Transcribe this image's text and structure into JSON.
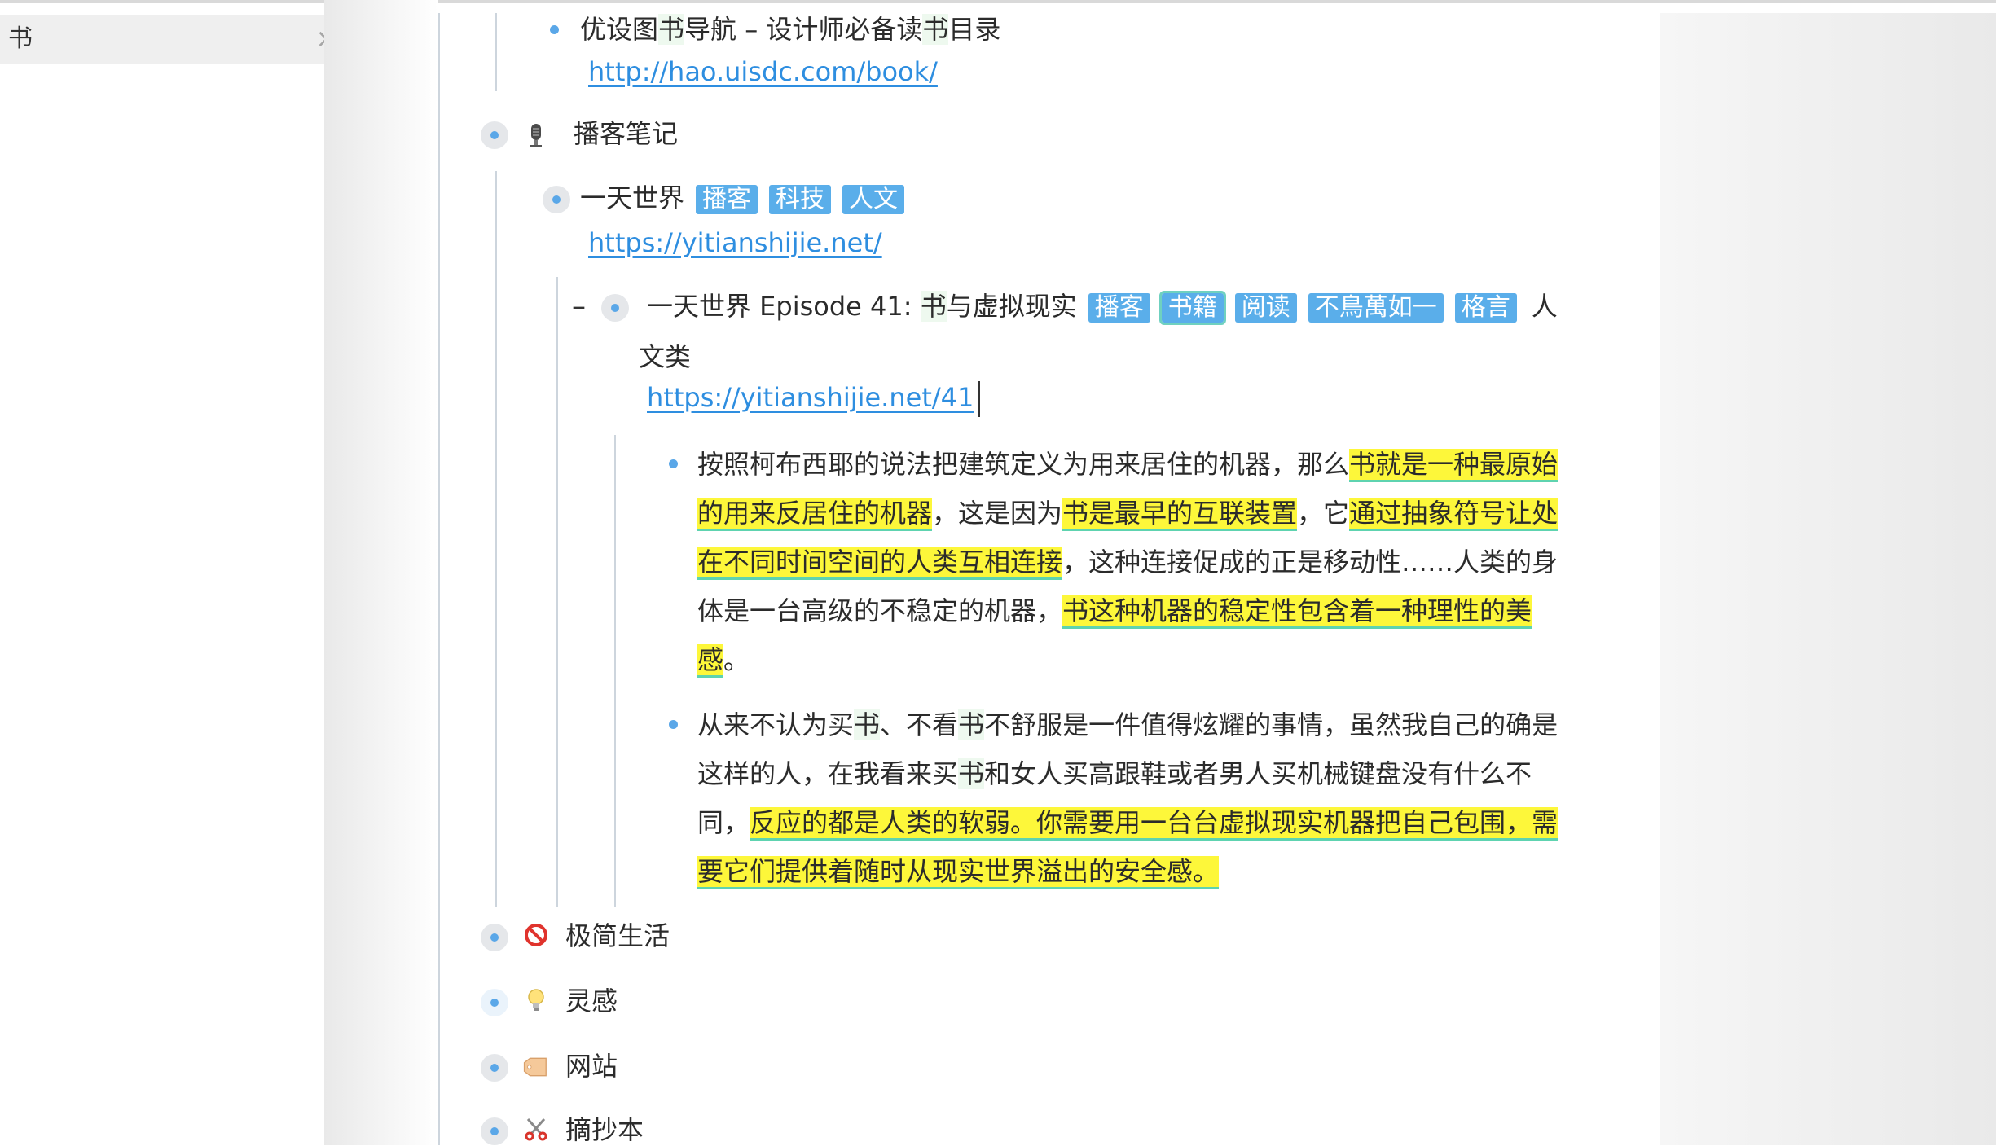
{
  "search": {
    "query": "书"
  },
  "items": {
    "uisdc_title": [
      "优设图",
      "书",
      "导航 – 设计师必备读",
      "书",
      "目录"
    ],
    "uisdc_url": "http://hao.uisdc.com/book/",
    "podcast_notes": "播客笔记",
    "yitian": "一天世界",
    "yitian_tags": [
      "播客",
      "科技",
      "人文"
    ],
    "yitian_url": "https://yitianshijie.net/",
    "episode_prefix": "一天世界 Episode 41: ",
    "episode_hit": "书",
    "episode_rest": "与虚拟现实",
    "episode_tags": [
      "播客",
      "书籍",
      "阅读",
      "不鳥萬如一",
      "格言"
    ],
    "episode_tail": "人",
    "episode_tail2": "文类",
    "episode_url": "https://yitianshijie.net/41",
    "note1": [
      "按照柯布西耶的说法把建筑定义为用来居住的机器，那么",
      "书就是一种最原始的用来反居住的机器",
      "，这是因为",
      "书是最早的互联装置",
      "，它",
      "通过抽象符号让处在不同时间空间的人类互相连接",
      "，这种连接促成的正是移动性……人类的身体是一台高级的不稳定的机器，",
      "书这种机器的稳定性包含着一种理性的美感",
      "。"
    ],
    "note2": [
      "从来不认为买",
      "书",
      "、不看",
      "书",
      "不舒服是一件值得炫耀的事情，虽然我自己的确是这样的人，在我看来买",
      "书",
      "和女人买高跟鞋或者男人买机械键盘没有什么不同，",
      "反应的都是人类的软弱。你需要用一台台虚拟现实机器把自己包围，需要它们提供着随时从现实世界溢出的安全感。"
    ],
    "minimal": "极简生活",
    "inspiration": "灵感",
    "website": "网站",
    "excerpts": "摘抄本"
  },
  "icons": {
    "podcast": "microphone-icon",
    "minimal": "prohibited-icon",
    "inspiration": "lightbulb-icon",
    "website": "tag-icon",
    "excerpts": "scissors-icon"
  },
  "colors": {
    "bullet": "#5aa7e8",
    "tag": "#5aaeea",
    "link": "#2e8ee0",
    "highlight": "#fdf73a",
    "highlight_underline": "#5ed3b0"
  }
}
